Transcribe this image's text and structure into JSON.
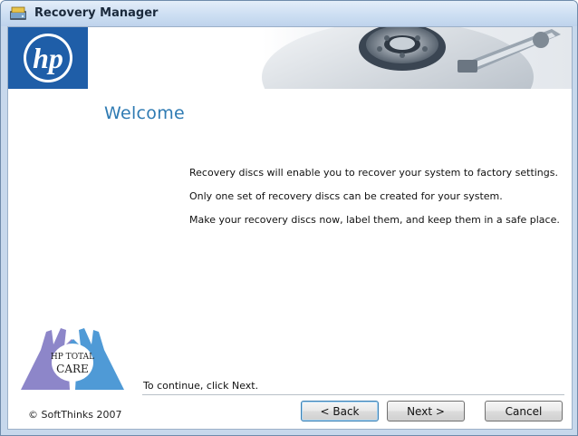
{
  "window": {
    "title": "Recovery Manager"
  },
  "banner": {
    "logo_text": "hp"
  },
  "page": {
    "heading": "Welcome",
    "messages": [
      "Recovery discs will enable you to recover your system to factory settings.",
      "Only one set of recovery discs can be created for your system.",
      "Make your recovery discs now, label them, and keep them in a safe place."
    ],
    "continue_hint": "To continue, click Next."
  },
  "care_logo": {
    "line1": "HP TOTAL",
    "line2": "CARE"
  },
  "footer": {
    "copyright": "© SoftThinks 2007",
    "back_label": "< Back",
    "next_label": "Next >",
    "cancel_label": "Cancel"
  },
  "colors": {
    "hp_blue": "#1f5ea8",
    "heading_blue": "#2f7bb3",
    "care_purple": "#8d86c9",
    "care_blue": "#4f9ad6"
  }
}
